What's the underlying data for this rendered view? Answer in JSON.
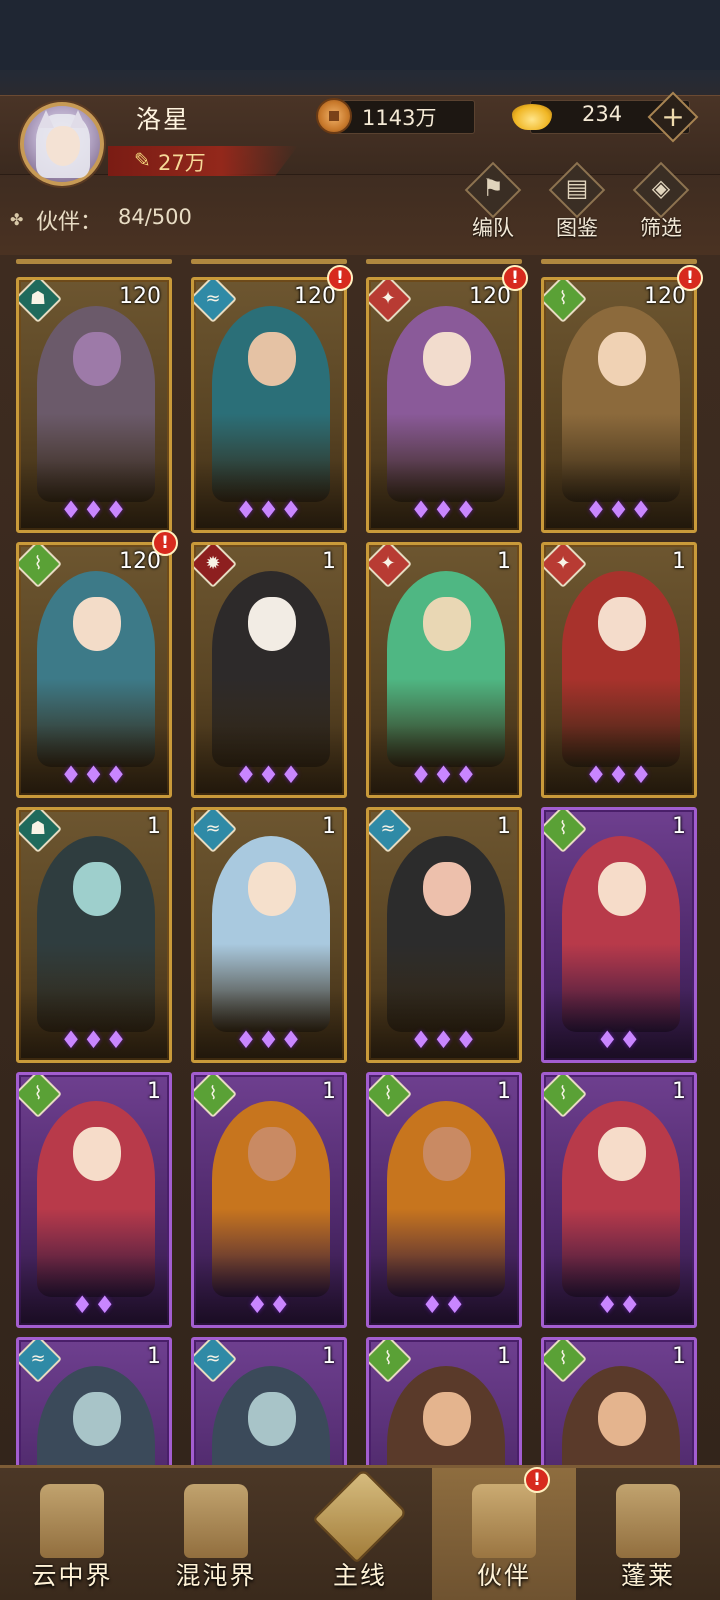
{
  "header": {
    "player_name": "洛星",
    "power": "27万",
    "copper": "1143万",
    "gold": "234",
    "add_symbol": "+",
    "partner_label": "伙伴：",
    "partner_count": "84/500",
    "tools": [
      {
        "label": "编队",
        "icon": "formation-flag-icon"
      },
      {
        "label": "图鉴",
        "icon": "codex-scroll-icon"
      },
      {
        "label": "筛选",
        "icon": "filter-diamond-icon"
      }
    ]
  },
  "cards": [
    {
      "level": "120",
      "element": "dark",
      "stars": "♦♦♦",
      "alert": false,
      "frame": "gold",
      "tone": "#6b5a6a",
      "skin": "#9d7aa8"
    },
    {
      "level": "120",
      "element": "water",
      "stars": "♦♦♦",
      "alert": true,
      "frame": "gold",
      "tone": "#2b6f78",
      "skin": "#e5c2a4"
    },
    {
      "level": "120",
      "element": "fire",
      "stars": "♦♦♦",
      "alert": true,
      "frame": "gold",
      "tone": "#8a5a99",
      "skin": "#f2dccd"
    },
    {
      "level": "120",
      "element": "wind",
      "stars": "♦♦♦",
      "alert": true,
      "frame": "gold",
      "tone": "#8c6a3c",
      "skin": "#f0d2b4"
    },
    {
      "level": "120",
      "element": "wind",
      "stars": "♦♦♦",
      "alert": true,
      "frame": "gold",
      "tone": "#3d7a88",
      "skin": "#f3dcc8"
    },
    {
      "level": "1",
      "element": "blood",
      "stars": "♦♦♦",
      "alert": false,
      "frame": "gold",
      "tone": "#2d2a2a",
      "skin": "#f2ece4"
    },
    {
      "level": "1",
      "element": "fire",
      "stars": "♦♦♦",
      "alert": false,
      "frame": "gold",
      "tone": "#4fb783",
      "skin": "#e9d7b4"
    },
    {
      "level": "1",
      "element": "fire",
      "stars": "♦♦♦",
      "alert": false,
      "frame": "gold",
      "tone": "#a8322c",
      "skin": "#f4dccb"
    },
    {
      "level": "1",
      "element": "dark",
      "stars": "♦♦♦",
      "alert": false,
      "frame": "gold",
      "tone": "#2f3d3f",
      "skin": "#9ecfcc"
    },
    {
      "level": "1",
      "element": "water",
      "stars": "♦♦♦",
      "alert": false,
      "frame": "gold",
      "tone": "#a9c9df",
      "skin": "#f5e0cc"
    },
    {
      "level": "1",
      "element": "water",
      "stars": "♦♦♦",
      "alert": false,
      "frame": "gold",
      "tone": "#2c2c2c",
      "skin": "#edc0ac"
    },
    {
      "level": "1",
      "element": "wind",
      "stars": "♦♦",
      "alert": false,
      "frame": "purple",
      "tone": "#b83a4a",
      "skin": "#f6dcc9"
    },
    {
      "level": "1",
      "element": "wind",
      "stars": "♦♦",
      "alert": false,
      "frame": "purple",
      "tone": "#b83a4a",
      "skin": "#f6dcc9"
    },
    {
      "level": "1",
      "element": "wind",
      "stars": "♦♦",
      "alert": false,
      "frame": "purple",
      "tone": "#c7751e",
      "skin": "#c98a63"
    },
    {
      "level": "1",
      "element": "wind",
      "stars": "♦♦",
      "alert": false,
      "frame": "purple",
      "tone": "#c7751e",
      "skin": "#c98a63"
    },
    {
      "level": "1",
      "element": "wind",
      "stars": "♦♦",
      "alert": false,
      "frame": "purple",
      "tone": "#b83a4a",
      "skin": "#f6dcc9"
    },
    {
      "level": "1",
      "element": "water",
      "stars": "",
      "alert": false,
      "frame": "purple",
      "tone": "#3b4a5a",
      "skin": "#a8c4c8"
    },
    {
      "level": "1",
      "element": "water",
      "stars": "",
      "alert": false,
      "frame": "purple",
      "tone": "#3b4a5a",
      "skin": "#a8c4c8"
    },
    {
      "level": "1",
      "element": "wind",
      "stars": "",
      "alert": false,
      "frame": "purple",
      "tone": "#5a3a2a",
      "skin": "#e4b48e"
    },
    {
      "level": "1",
      "element": "wind",
      "stars": "",
      "alert": false,
      "frame": "purple",
      "tone": "#5a3a2a",
      "skin": "#e4b48e"
    }
  ],
  "element_glyphs": {
    "wind": "⌇",
    "water": "≈",
    "fire": "✦",
    "dark": "☗",
    "blood": "✹"
  },
  "alert_symbol": "!",
  "nav": [
    {
      "label": "云中界",
      "icon": "pavilion-icon",
      "active": false
    },
    {
      "label": "混沌界",
      "icon": "spire-icon",
      "active": false
    },
    {
      "label": "主线",
      "icon": "crossed-swords-icon",
      "active": false
    },
    {
      "label": "伙伴",
      "icon": "partner-figure-icon",
      "active": true
    },
    {
      "label": "蓬莱",
      "icon": "sage-statue-icon",
      "active": false
    }
  ],
  "nav_badge": "!"
}
